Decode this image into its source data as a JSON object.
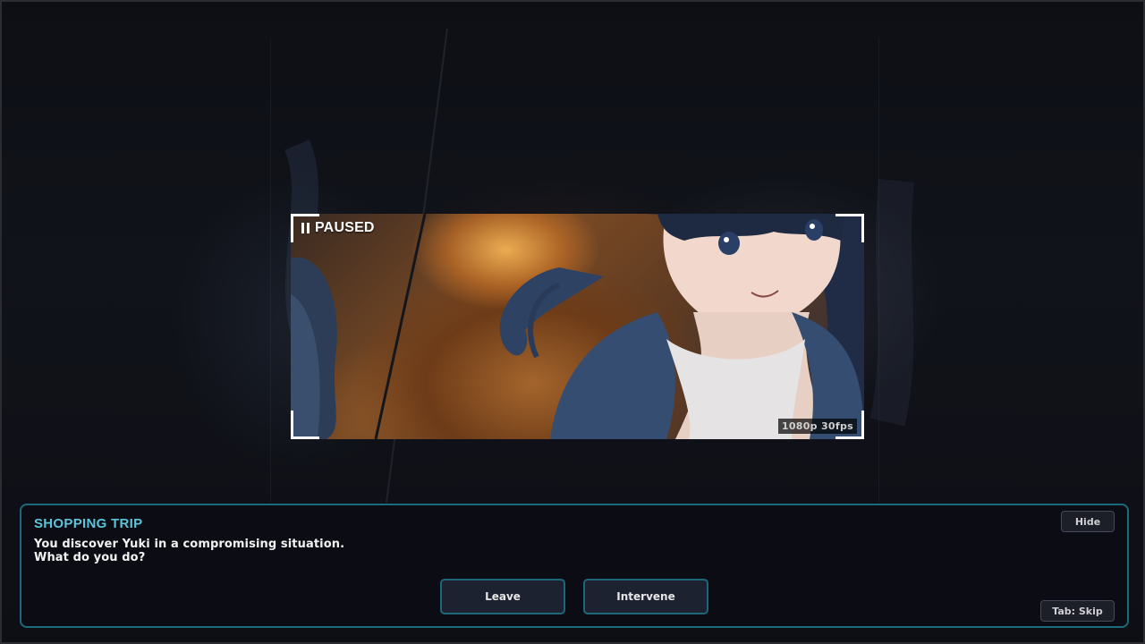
{
  "video": {
    "status": "PAUSED",
    "quality": "1080p 30fps"
  },
  "dialog": {
    "title": "SHOPPING TRIP",
    "line1": "You discover Yuki in a compromising situation.",
    "line2": "What do you do?",
    "choices": [
      {
        "label": "Leave"
      },
      {
        "label": "Intervene"
      }
    ],
    "hide_label": "Hide",
    "skip_label": "Tab: Skip"
  },
  "colors": {
    "accent": "#5ec4d9",
    "border": "#1b6b7c",
    "panel_bg": "#0b0c14"
  },
  "icons": {
    "pause": "pause-icon"
  }
}
